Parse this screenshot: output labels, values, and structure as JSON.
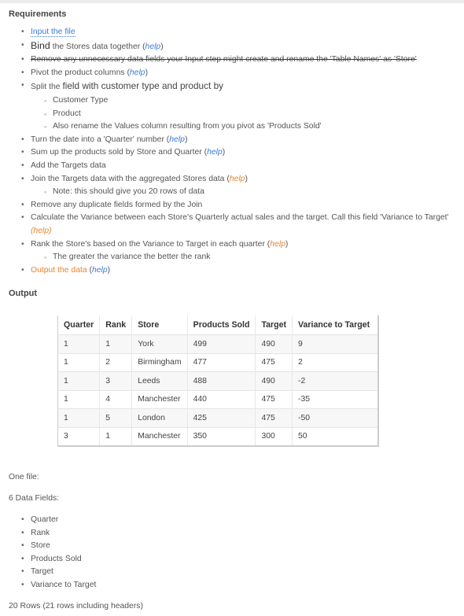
{
  "requirements": {
    "heading": "Requirements",
    "steps": [
      {
        "text": "Input the file"
      },
      {
        "lead": "Bind",
        "text": " the Stores data together (",
        "help": "help",
        "tail": ")"
      },
      {
        "text": "Remove any unnecessary data fields your Input step might create and rename the 'Table Names' as 'Store'"
      },
      {
        "text": "Pivot the product columns (",
        "help": "help",
        "tail": ")"
      },
      {
        "lead": "Split the ",
        "text": "field with customer type and product by",
        "sub": [
          "Customer Type",
          "Product",
          "Also rename the Values column resulting from you pivot as 'Products Sold'"
        ]
      },
      {
        "text": "Turn the date into a 'Quarter' number (",
        "help": "help",
        "tail": ")"
      },
      {
        "text": "Sum up the products sold by Store and Quarter (",
        "help": "help",
        "tail": ")"
      },
      {
        "text": "Add the Targets data"
      },
      {
        "text": "Join the Targets data with the aggregated Stores data (",
        "help": "help",
        "tail": ")",
        "sub": [
          "Note: this should give you 20 rows of data"
        ]
      },
      {
        "text": "Remove any duplicate fields formed by the Join"
      },
      {
        "text": "Calculate the Variance between each Store's Quarterly actual sales and the target. Call this field 'Variance to Target'",
        "help_line": "(help)"
      },
      {
        "text": "Rank the Store's based on the Variance to Target in each quarter (",
        "help": "help",
        "tail": ")",
        "sub": [
          "The greater the variance the better the rank"
        ]
      },
      {
        "text": "Output the data",
        "text2": " (",
        "help": "help",
        "tail": ")"
      }
    ]
  },
  "output": {
    "heading": "Output",
    "columns": [
      "Quarter",
      "Rank",
      "Store",
      "Products Sold",
      "Target",
      "Variance to Target"
    ],
    "rows": [
      [
        "1",
        "1",
        "York",
        "499",
        "490",
        "9"
      ],
      [
        "1",
        "2",
        "Birmingham",
        "477",
        "475",
        "2"
      ],
      [
        "1",
        "3",
        "Leeds",
        "488",
        "490",
        "-2"
      ],
      [
        "1",
        "4",
        "Manchester",
        "440",
        "475",
        "-35"
      ],
      [
        "1",
        "5",
        "London",
        "425",
        "475",
        "-50"
      ],
      [
        "3",
        "1",
        "Manchester",
        "350",
        "300",
        "50"
      ]
    ],
    "one_file": "One file:",
    "fields_count": "6 Data Fields:",
    "fields": [
      "Quarter",
      "Rank",
      "Store",
      "Products Sold",
      "Target",
      "Variance to Target"
    ],
    "rows_note": "20 Rows (21 rows including headers)"
  }
}
